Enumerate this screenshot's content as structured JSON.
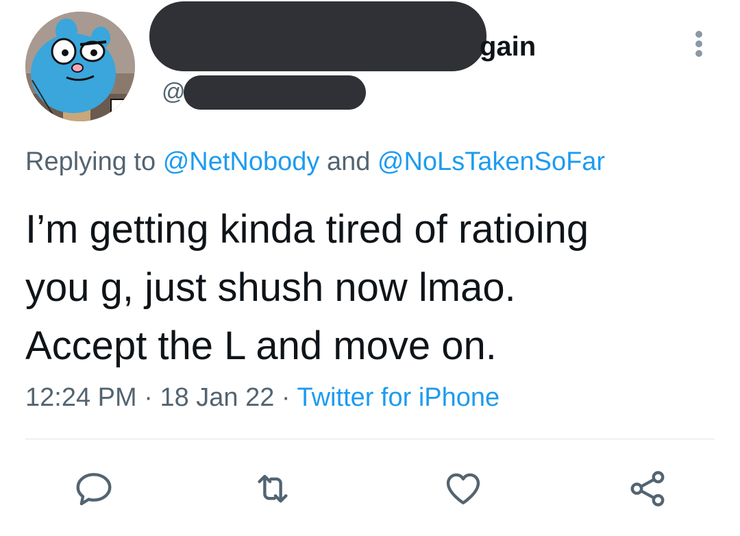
{
  "author": {
    "name_visible_suffix": "gain",
    "handle_prefix": "@"
  },
  "reply_context": {
    "prefix": "Replying to",
    "mention_1": "@NetNobody",
    "conjunction": "and",
    "mention_2": "@NoLsTakenSoFar"
  },
  "tweet": {
    "lines": [
      "I’m getting kinda tired of ratioing",
      "you g, just shush now lmao.",
      "Accept the L and move on."
    ]
  },
  "meta": {
    "time": "12:24 PM",
    "separator": "·",
    "date": "18 Jan 22",
    "source": "Twitter for iPhone"
  },
  "actions": {
    "icons": [
      "reply-icon",
      "retweet-icon",
      "like-icon",
      "share-icon"
    ]
  },
  "colors": {
    "link": "#1d9bf0",
    "muted": "#536471",
    "text": "#0f1419",
    "redaction": "#2f3136"
  }
}
